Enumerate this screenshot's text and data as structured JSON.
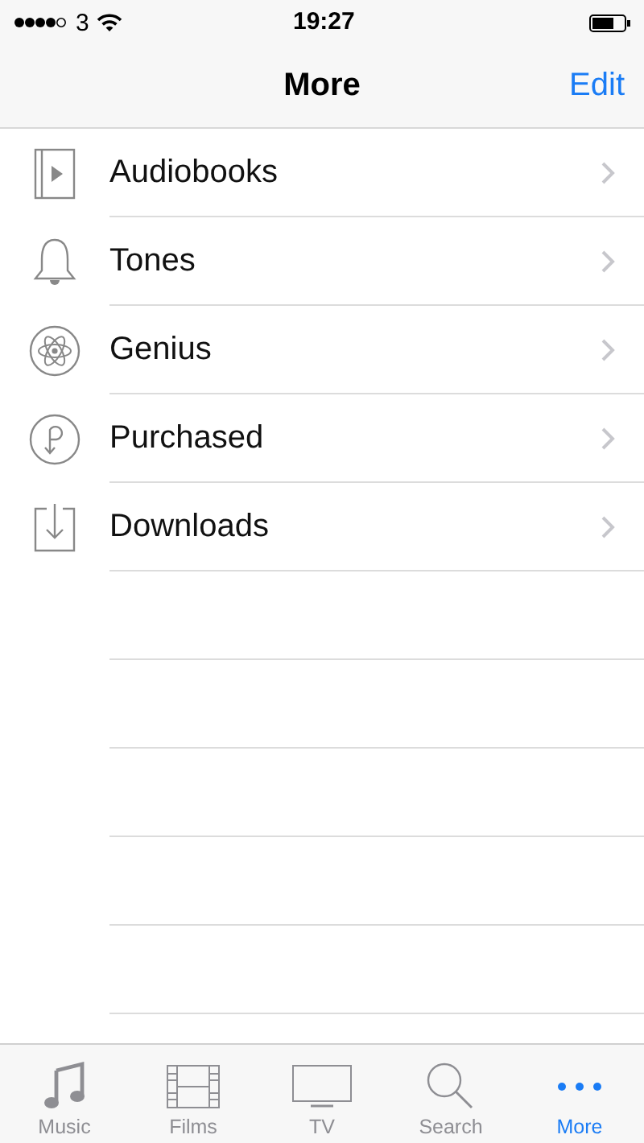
{
  "status_bar": {
    "carrier": "3",
    "time": "19:27"
  },
  "nav_bar": {
    "title": "More",
    "action": "Edit"
  },
  "items": [
    {
      "label": "Audiobooks"
    },
    {
      "label": "Tones"
    },
    {
      "label": "Genius"
    },
    {
      "label": "Purchased"
    },
    {
      "label": "Downloads"
    }
  ],
  "tab_bar": [
    {
      "label": "Music",
      "selected": false
    },
    {
      "label": "Films",
      "selected": false
    },
    {
      "label": "TV",
      "selected": false
    },
    {
      "label": "Search",
      "selected": false
    },
    {
      "label": "More",
      "selected": true
    }
  ]
}
